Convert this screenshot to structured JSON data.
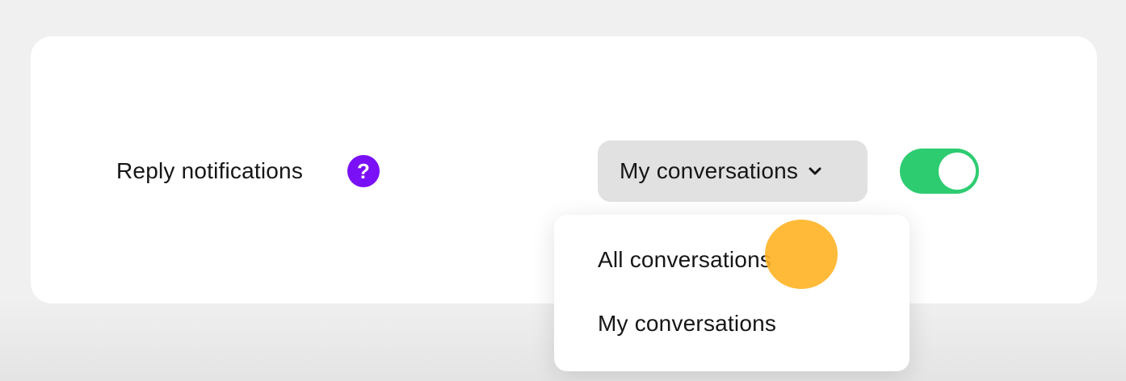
{
  "setting": {
    "label": "Reply notifications",
    "help_symbol": "?"
  },
  "dropdown": {
    "selected": "My conversations",
    "options": [
      "All conversations",
      "My conversations"
    ]
  },
  "toggle": {
    "state": "on"
  },
  "icons": {
    "help": "help-icon",
    "chevron": "chevron-down-icon"
  },
  "colors": {
    "help_badge": "#7a10f5",
    "toggle_on": "#2ecc71",
    "dropdown_bg": "#e1e1e1",
    "cursor_highlight": "#ffb224"
  }
}
